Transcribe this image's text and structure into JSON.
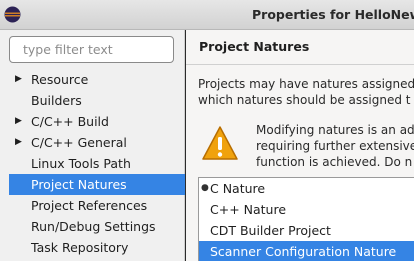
{
  "window": {
    "title": "Properties for HelloNew"
  },
  "sidebar": {
    "filter_placeholder": "type filter text",
    "items": [
      {
        "label": "Resource",
        "expandable": true,
        "selected": false
      },
      {
        "label": "Builders",
        "expandable": false,
        "selected": false
      },
      {
        "label": "C/C++ Build",
        "expandable": true,
        "selected": false
      },
      {
        "label": "C/C++ General",
        "expandable": true,
        "selected": false
      },
      {
        "label": "Linux Tools Path",
        "expandable": false,
        "selected": false
      },
      {
        "label": "Project Natures",
        "expandable": false,
        "selected": true
      },
      {
        "label": "Project References",
        "expandable": false,
        "selected": false
      },
      {
        "label": "Run/Debug Settings",
        "expandable": false,
        "selected": false
      },
      {
        "label": "Task Repository",
        "expandable": false,
        "selected": false
      }
    ]
  },
  "main": {
    "title": "Project Natures",
    "description_line1": "Projects may have natures assigned",
    "description_line2": "which natures should be assigned t",
    "warning_line1": "Modifying natures is an ad",
    "warning_line2": "requiring further extensive",
    "warning_line3": "function is achieved. Do n",
    "natures": [
      {
        "label": "C Nature",
        "selected": false,
        "primary": true
      },
      {
        "label": "C++ Nature",
        "selected": false,
        "primary": false
      },
      {
        "label": "CDT Builder Project",
        "selected": false,
        "primary": false
      },
      {
        "label": "Scanner Configuration Nature",
        "selected": true,
        "primary": false
      }
    ]
  },
  "colors": {
    "selection": "#3584e4",
    "warning": "#f0a20d"
  },
  "icons": {
    "app": "eclipse-icon",
    "warning": "warning-icon",
    "expander": "triangle-right-icon"
  }
}
